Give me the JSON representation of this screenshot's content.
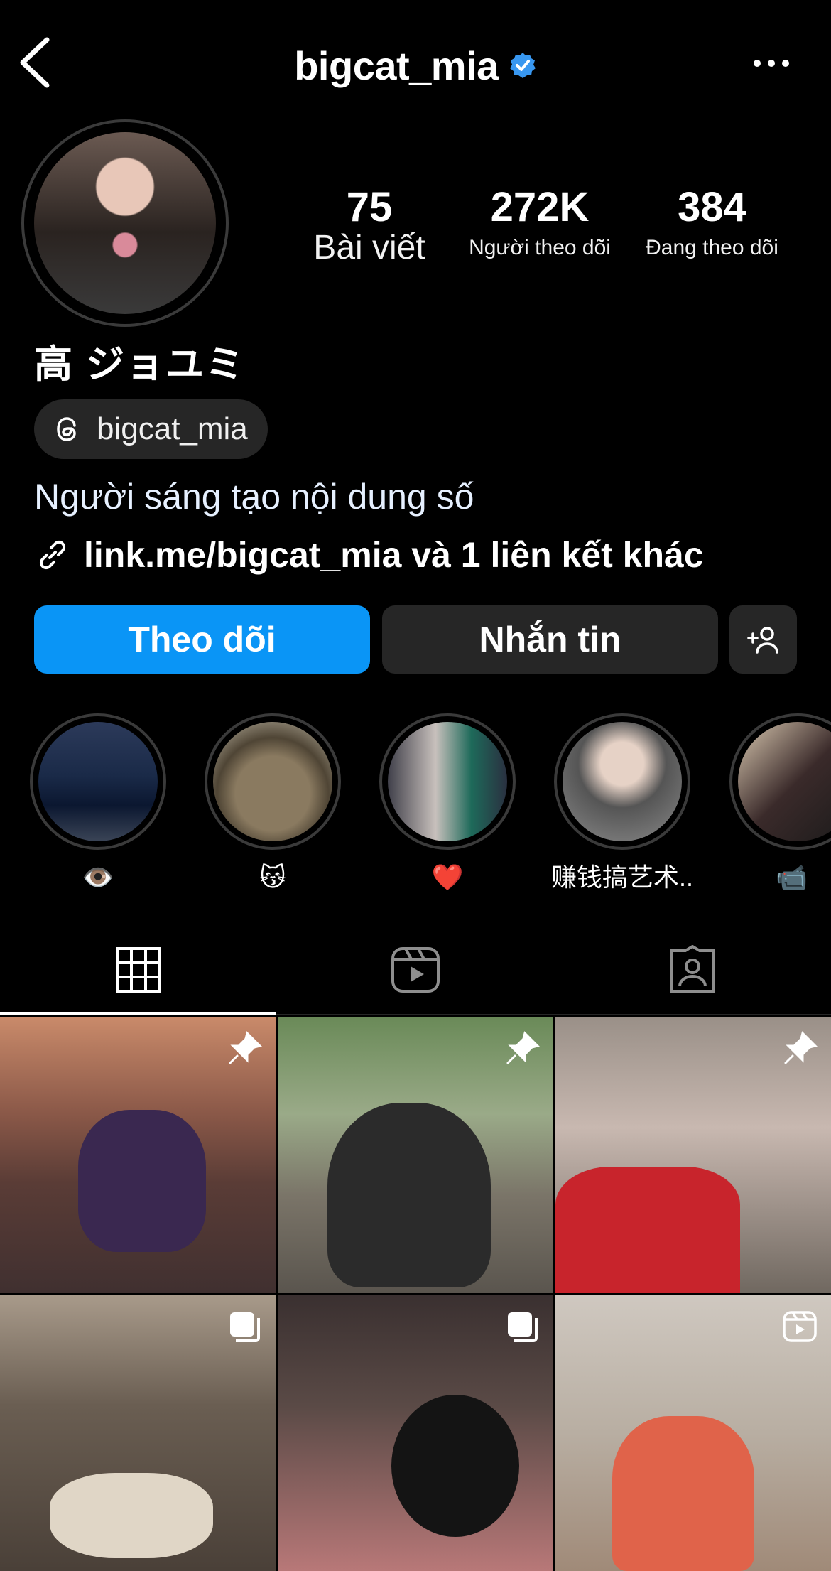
{
  "header": {
    "title": "bigcat_mia",
    "verified": true,
    "back_icon": "chevron-left-icon",
    "more_icon": "more-horizontal-icon"
  },
  "stats": {
    "posts": {
      "value": "75",
      "label": "Bài viết"
    },
    "followers": {
      "value": "272K",
      "label": "Người theo dõi"
    },
    "following": {
      "value": "384",
      "label": "Đang theo dõi"
    }
  },
  "profile": {
    "display_name": "高 ジョユミ",
    "threads_handle": "bigcat_mia",
    "category": "Người sáng tạo nội dung số",
    "link": "link.me/bigcat_mia và 1 liên kết khác"
  },
  "actions": {
    "follow": "Theo dõi",
    "message": "Nhắn tin"
  },
  "highlights": [
    {
      "label": "👁️"
    },
    {
      "label": "😽"
    },
    {
      "label": "❤️"
    },
    {
      "label": "赚钱搞艺术..."
    },
    {
      "label": "📹"
    }
  ],
  "tabs": [
    {
      "name": "posts-grid",
      "icon": "grid-icon",
      "active": true
    },
    {
      "name": "reels",
      "icon": "reels-icon",
      "active": false
    },
    {
      "name": "tagged",
      "icon": "tagged-person-icon",
      "active": false
    }
  ],
  "colors": {
    "follow": "#0a95f6",
    "verified": "#3897f0",
    "dark_button": "#262626"
  },
  "grid": [
    {
      "badge": "pin-icon"
    },
    {
      "badge": "pin-icon"
    },
    {
      "badge": "pin-icon"
    },
    {
      "badge": "carousel-icon"
    },
    {
      "badge": "carousel-icon"
    },
    {
      "badge": "reel-icon"
    }
  ]
}
